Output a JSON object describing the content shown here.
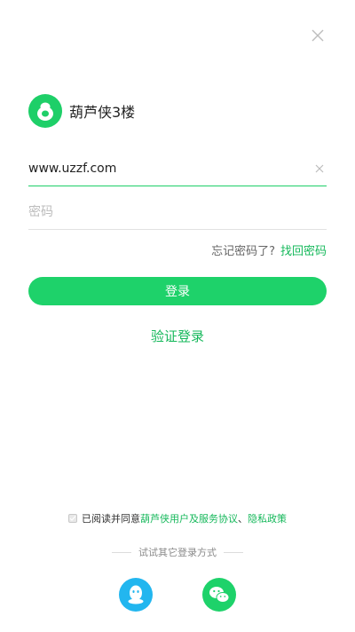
{
  "brand": {
    "name": "葫芦侠3楼"
  },
  "login": {
    "username_value": "www.uzzf.com",
    "password_placeholder": "密码",
    "forgot_text": "忘记密码了?",
    "forgot_link": "找回密码",
    "login_button": "登录",
    "verify_login": "验证登录"
  },
  "agreement": {
    "prefix": "已阅读并同意",
    "user_link": "葫芦侠用户及服务协议",
    "separator": "、",
    "privacy_link": "隐私政策"
  },
  "other_login": {
    "label": "试试其它登录方式",
    "options": [
      "qq-icon",
      "wechat-icon"
    ]
  },
  "colors": {
    "accent": "#1ed26a",
    "link": "#16b85b",
    "qq": "#22b6ef"
  }
}
